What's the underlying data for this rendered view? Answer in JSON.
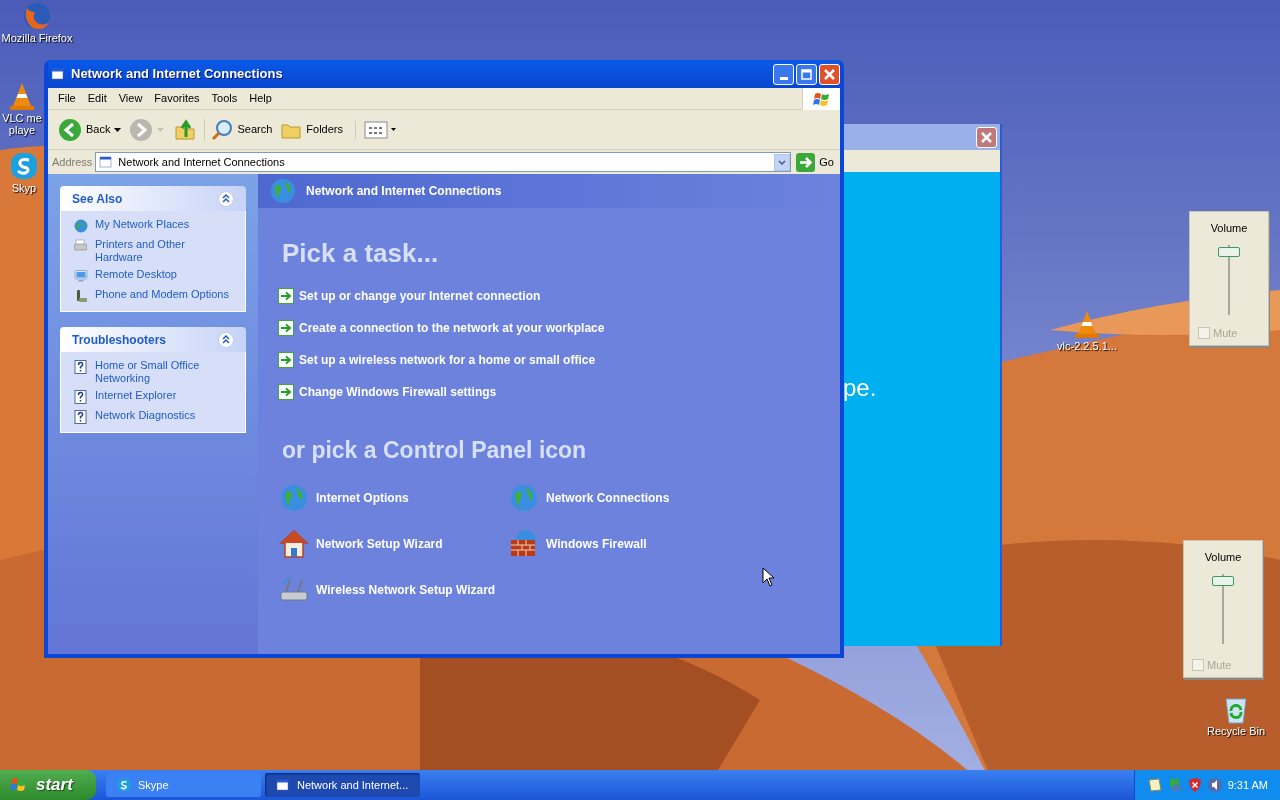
{
  "desktop_icons": [
    {
      "kind": "firefox",
      "label": "Mozilla Firefox"
    },
    {
      "kind": "cone",
      "label": "VLC me playe"
    },
    {
      "kind": "chat",
      "label": "Skyp"
    },
    {
      "kind": "cone",
      "label": "vlc-2.2.5.1..."
    },
    {
      "kind": "bin",
      "label": "Recycle Bin"
    }
  ],
  "background_window": {
    "text": "pe."
  },
  "volume_panels": [
    {
      "title": "Volume",
      "mute": {
        "label": "Mute",
        "checked": false,
        "disabled": true
      }
    },
    {
      "title": "Volume",
      "mute": {
        "label": "Mute",
        "checked": false,
        "disabled": true
      }
    }
  ],
  "window": {
    "title": "Network and Internet Connections",
    "menu": [
      "File",
      "Edit",
      "View",
      "Favorites",
      "Tools",
      "Help"
    ],
    "toolbar": [
      {
        "kind": "back",
        "label": "Back",
        "disabled": false
      },
      {
        "kind": "forward",
        "disabled": true
      },
      {
        "kind": "up"
      },
      {
        "kind": "search",
        "label": "Search"
      },
      {
        "kind": "folders",
        "label": "Folders"
      },
      {
        "kind": "views"
      }
    ],
    "address": {
      "label": "Address",
      "value": "Network and Internet Connections",
      "go": "Go"
    },
    "side_panels": [
      {
        "title": "See Also",
        "expanded": true,
        "items": [
          {
            "kind": "globe",
            "label": "My Network Places"
          },
          {
            "kind": "printer",
            "label": "Printers and Other Hardware"
          },
          {
            "kind": "remote",
            "label": "Remote Desktop"
          },
          {
            "kind": "phone",
            "label": "Phone and Modem Options"
          }
        ]
      },
      {
        "title": "Troubleshooters",
        "expanded": true,
        "items": [
          {
            "kind": "help",
            "label": "Home or Small Office Networking"
          },
          {
            "kind": "help",
            "label": "Internet Explorer"
          },
          {
            "kind": "help",
            "label": "Network Diagnostics"
          }
        ]
      }
    ],
    "header": "Network and Internet Connections",
    "task_heading": "Pick a task...",
    "tasks": [
      "Set up or change your Internet connection",
      "Create a connection to the network at your workplace",
      "Set up a wireless network for a home or small office",
      "Change Windows Firewall settings"
    ],
    "icon_heading": "or pick a Control Panel icon",
    "control_panel_icons": [
      {
        "kind": "globe",
        "label": "Internet Options"
      },
      {
        "kind": "globe",
        "label": "Network Connections"
      },
      {
        "kind": "house",
        "label": "Network Setup Wizard"
      },
      {
        "kind": "wall",
        "label": "Windows Firewall"
      },
      {
        "kind": "wireless",
        "label": "Wireless Network Setup Wizard"
      }
    ]
  },
  "taskbar": {
    "start": "start",
    "buttons": [
      {
        "kind": "chat",
        "label": "Skype",
        "selected": false
      },
      {
        "kind": "window",
        "label": "Network and Internet...",
        "selected": true
      }
    ],
    "clock": "9:31 AM"
  }
}
